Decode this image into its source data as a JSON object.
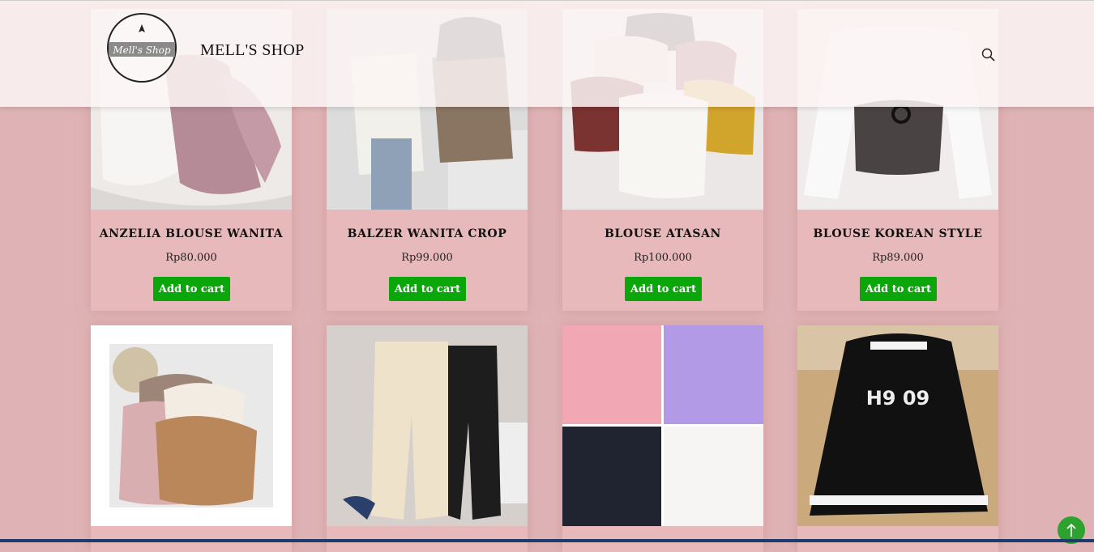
{
  "header": {
    "logo_text": "Mell's Shop",
    "shop_name": "MELL'S SHOP",
    "search_icon": "search-icon"
  },
  "products": [
    {
      "name": "ANZELIA BLOUSE WANITA",
      "price": "Rp80.000",
      "cart_label": "Add to cart"
    },
    {
      "name": "BALZER WANITA CROP",
      "price": "Rp99.000",
      "cart_label": "Add to cart"
    },
    {
      "name": "BLOUSE ATASAN",
      "price": "Rp100.000",
      "cart_label": "Add to cart"
    },
    {
      "name": "BLOUSE KOREAN STYLE",
      "price": "Rp89.000",
      "cart_label": "Add to cart"
    }
  ],
  "hoodie_text": "H9 09",
  "scroll_top_icon": "arrow-up-icon",
  "colors": {
    "background": "#dfb3b5",
    "card": "#e7b9bb",
    "button": "#0aa60a",
    "header": "#fcf5f5"
  }
}
